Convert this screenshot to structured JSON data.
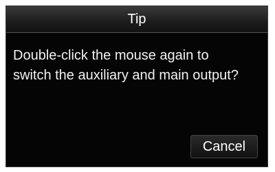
{
  "dialog": {
    "title": "Tip",
    "message": "Double-click the mouse again to\nswitch the auxiliary and main output?",
    "cancel_label": "Cancel"
  },
  "colors": {
    "background": "#050505",
    "text": "#f4f4f4",
    "page": "#ffffff"
  }
}
